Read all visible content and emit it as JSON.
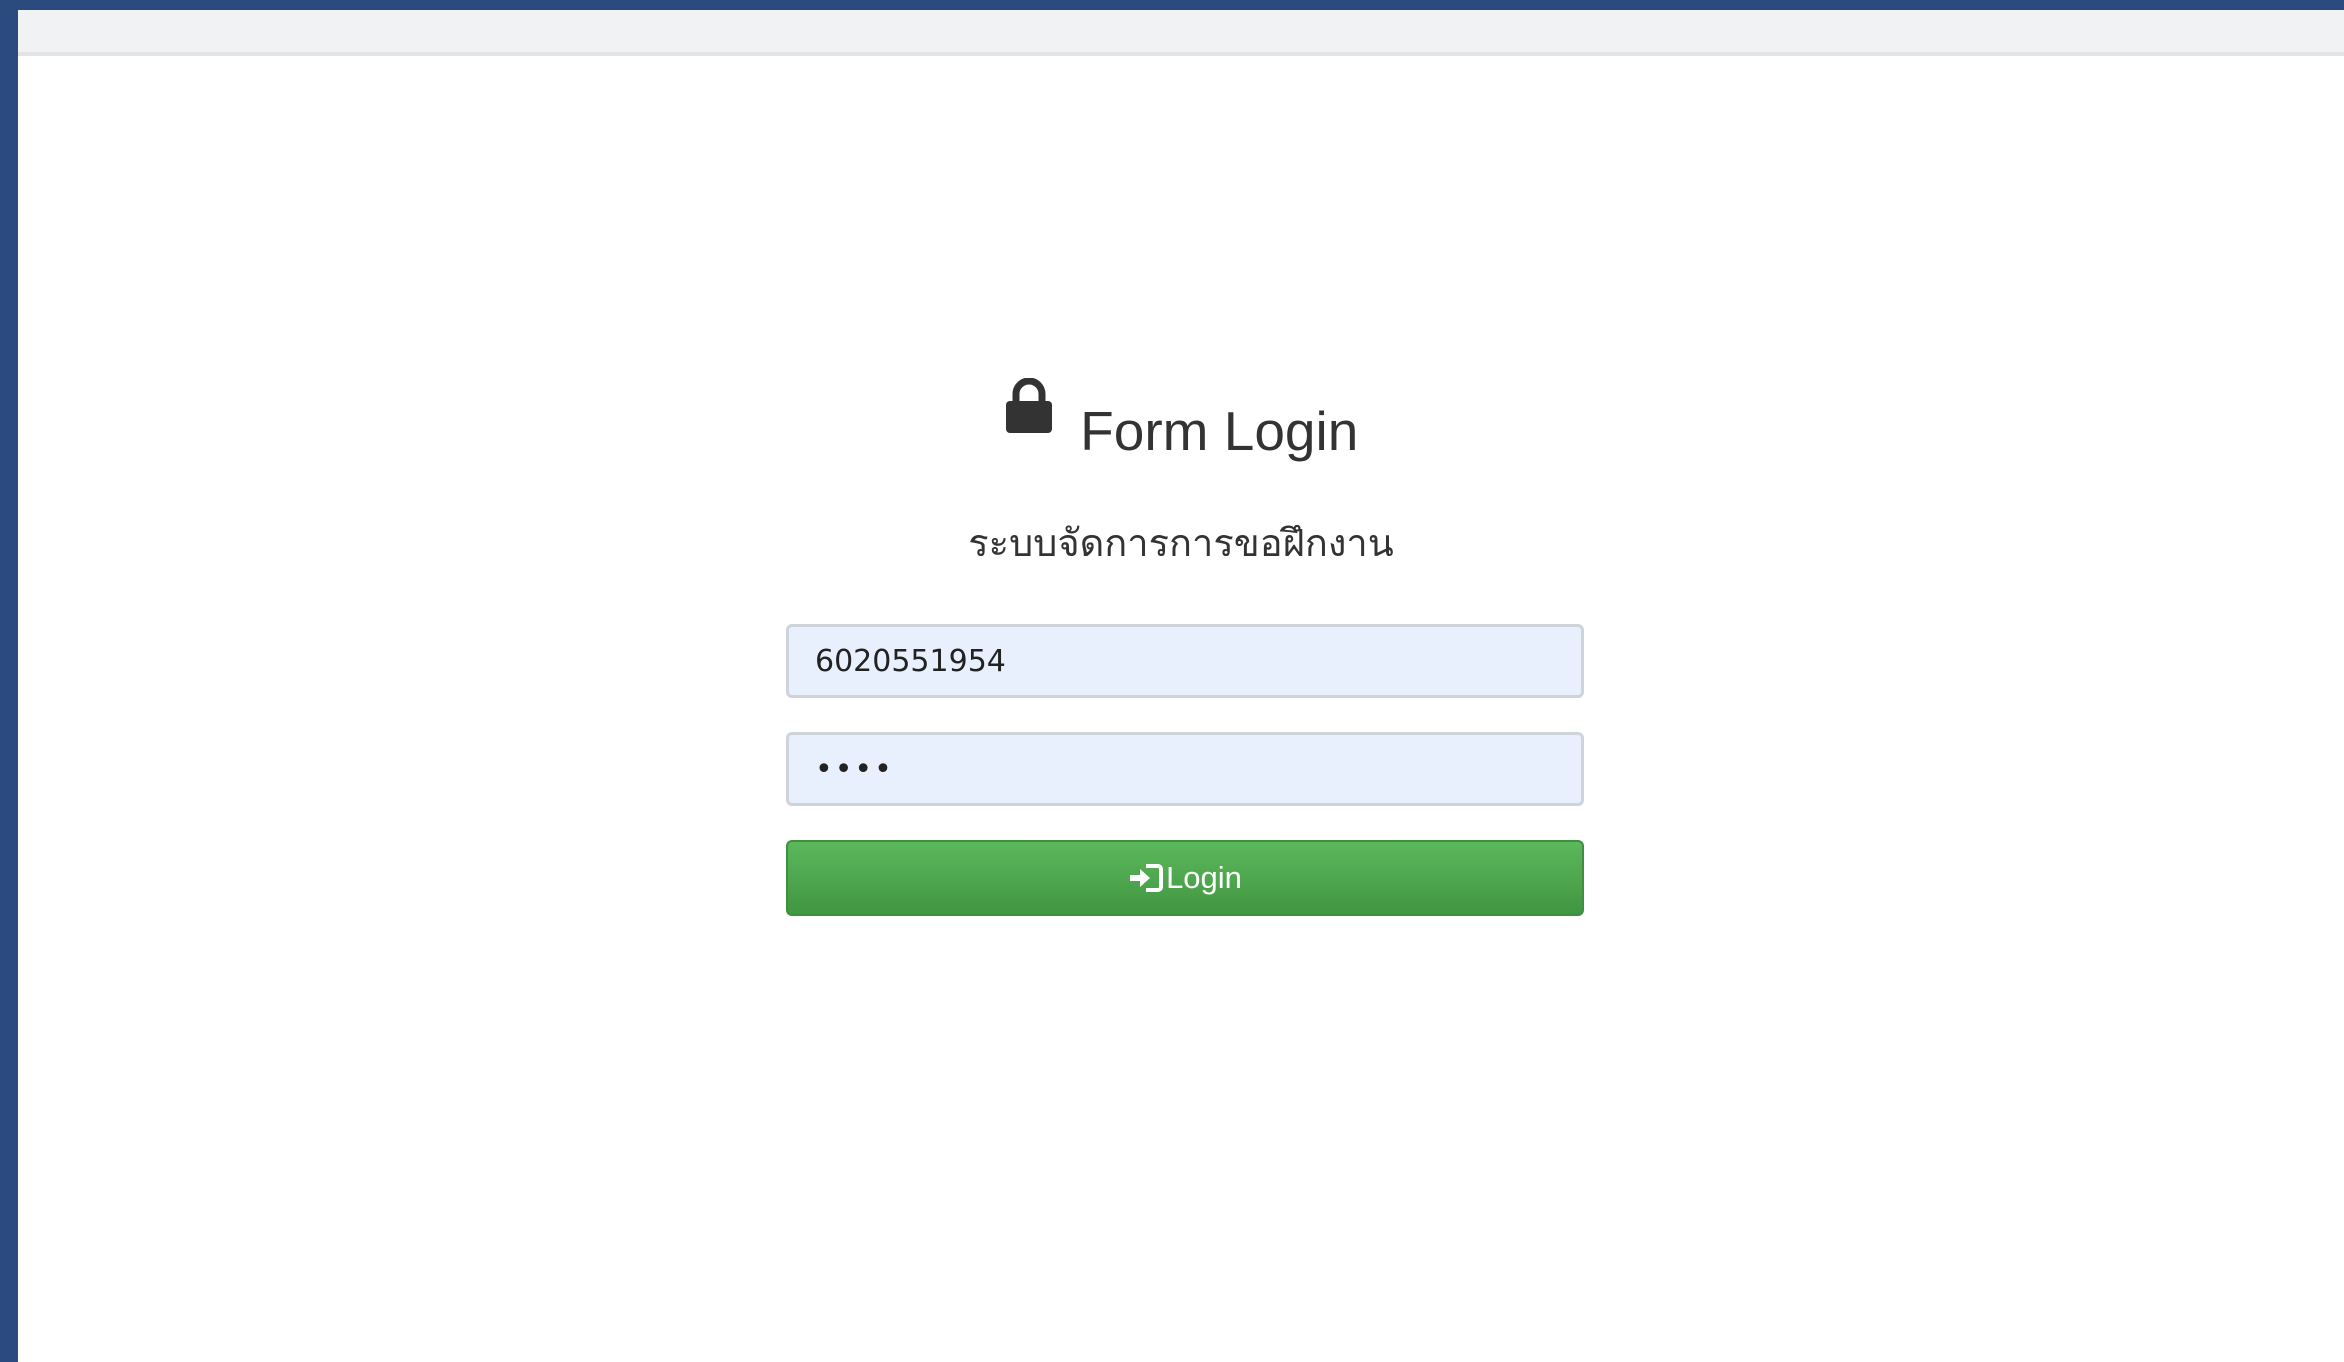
{
  "form": {
    "title": "Form Login",
    "subtitle": "ระบบจัดการการขอฝึกงาน",
    "username_value": "6020551954",
    "password_value": "••••",
    "login_label": "Login",
    "lock_icon": "lock-icon",
    "login_icon": "sign-in-icon"
  },
  "colors": {
    "accent": "#4cae4c",
    "input_bg": "#e8f0fe",
    "frame_border": "#2b4a7e"
  }
}
